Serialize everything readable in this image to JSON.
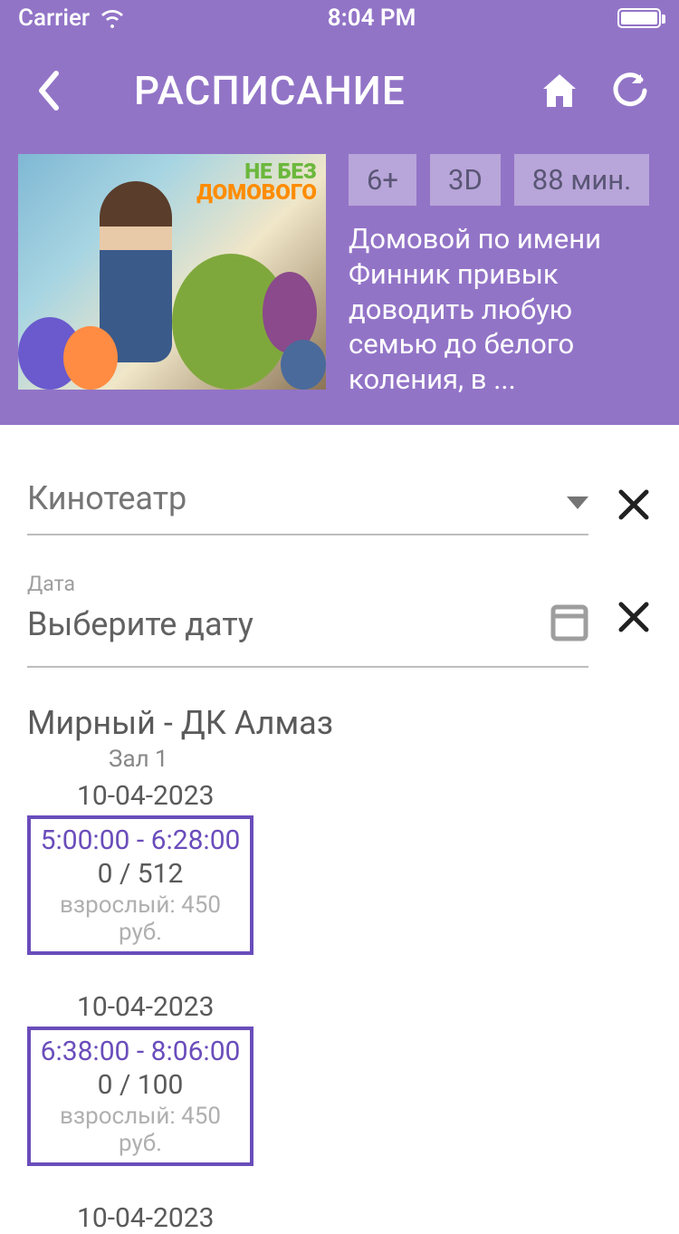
{
  "status": {
    "carrier": "Carrier",
    "time": "8:04 PM"
  },
  "nav": {
    "title": "РАСПИСАНИЕ"
  },
  "movie": {
    "poster_line1": "НЕ БЕЗ",
    "poster_line2": "ДОМОВОГО",
    "badges": {
      "age": "6+",
      "format": "3D",
      "duration": "88 мин."
    },
    "description": "Домовой по имени Финник привык доводить любую семью до белого коления, в ..."
  },
  "filters": {
    "cinema": {
      "label": "Кинотеатр"
    },
    "date": {
      "label": "Дата",
      "placeholder": "Выберите дату"
    }
  },
  "venue": {
    "name": "Мирный - ДК Алмаз",
    "hall": "Зал 1"
  },
  "sessions": [
    {
      "date": "10-04-2023",
      "time": "5:00:00 - 6:28:00",
      "seats": "0 / 512",
      "price": "взрослый: 450 руб."
    },
    {
      "date": "10-04-2023",
      "time": "6:38:00 - 8:06:00",
      "seats": "0 / 100",
      "price": "взрослый: 450 руб."
    },
    {
      "date": "10-04-2023",
      "time": "",
      "seats": "",
      "price": ""
    }
  ]
}
